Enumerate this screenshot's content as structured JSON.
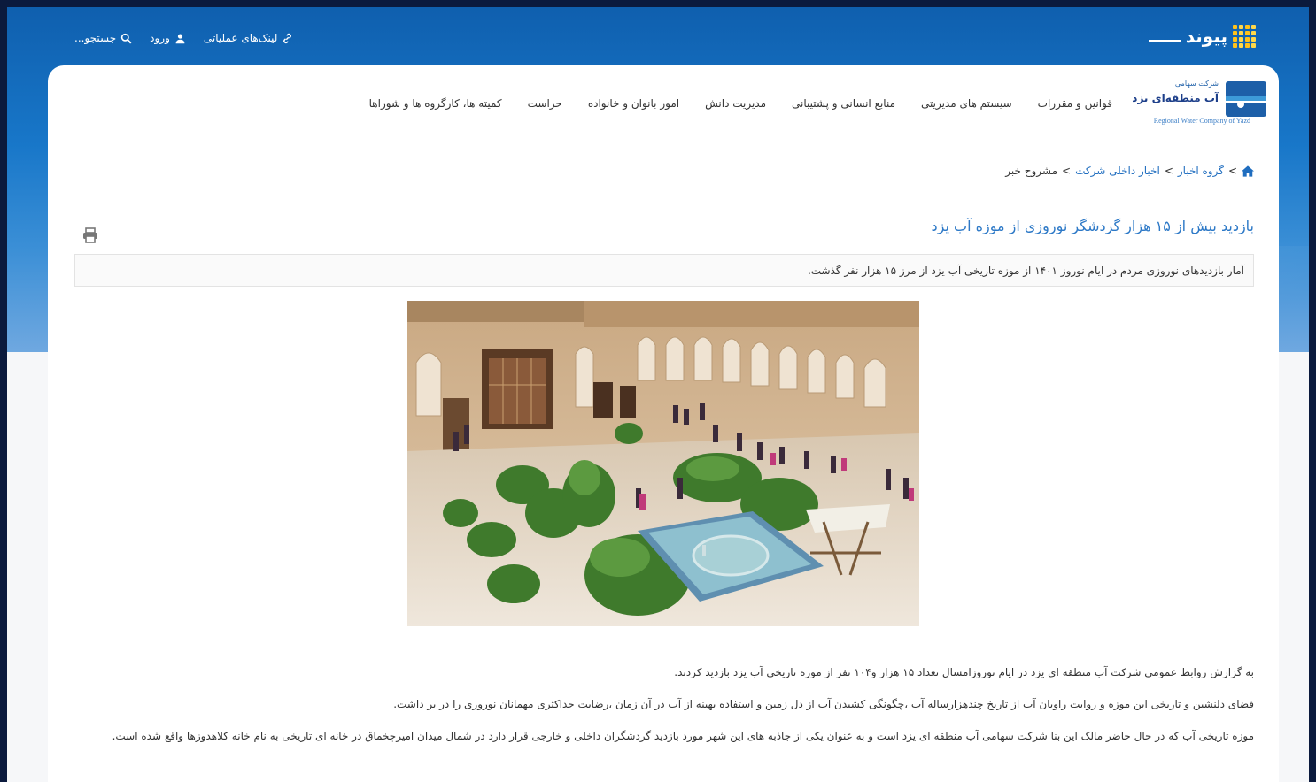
{
  "brand": {
    "name": "پیوند"
  },
  "top_links": {
    "operational_links": "لینک‌های عملیاتی",
    "login": "ورود",
    "search": "جستجو..."
  },
  "logo": {
    "small": "شرکت سهامی",
    "main": "آب منطقه‌ای یزد",
    "english": "Regional Water Company of Yazd"
  },
  "nav": {
    "items": [
      {
        "label": "قوانین و مقررات"
      },
      {
        "label": "سیستم های مدیریتی"
      },
      {
        "label": "منابع انسانی و پشتیبانی"
      },
      {
        "label": "مدیریت دانش"
      },
      {
        "label": "امور بانوان و خانواده"
      },
      {
        "label": "حراست"
      },
      {
        "label": "کمیته ها، کارگروه ها و شوراها"
      }
    ]
  },
  "breadcrumb": {
    "sep": ">",
    "items": [
      {
        "label": "گروه اخبار"
      },
      {
        "label": "اخبار داخلی شرکت"
      },
      {
        "label": "مشروح خبر"
      }
    ]
  },
  "article": {
    "title": "بازدید بیش از ۱۵ هزار گردشگر نوروزی از موزه آب یزد",
    "lead": "آمار بازدیدهای نوروزی مردم در ایام نوروز ۱۴۰۱ از موزه تاریخی آب یزد از مرز ۱۵ هزار نفر گذشت.",
    "paragraphs": [
      "به گزارش روابط عمومی شرکت آب منطقه ای یزد در ایام نوروزامسال تعداد ۱۵ هزار و۱۰۴ نفر از موزه تاریخی آب یزد بازدید کردند.",
      "فضای دلنشین و تاریخی این موزه و روایت راویان آب از تاریخ چندهزارساله آب ،چگونگی کشیدن آب از دل زمین و استفاده بهینه از آب در آن زمان ،رضایت حداکثری مهمانان نوروزی را در بر داشت.",
      "موزه تاریخی آب که  در حال حاضر مالک این بنا شرکت سهامی آب منطقه ای یزد است و به عنوان یکی از جاذبه های این شهر مورد بازدید گردشگران داخلی و خارجی قرار دارد در شمال میدان امیرچخماق در خانه ای تاریخی به نام خانه کلاهدوزها واقع شده است."
    ]
  },
  "colors": {
    "primary": "#1f6dbf",
    "brand_gold": "#ffd84a"
  }
}
